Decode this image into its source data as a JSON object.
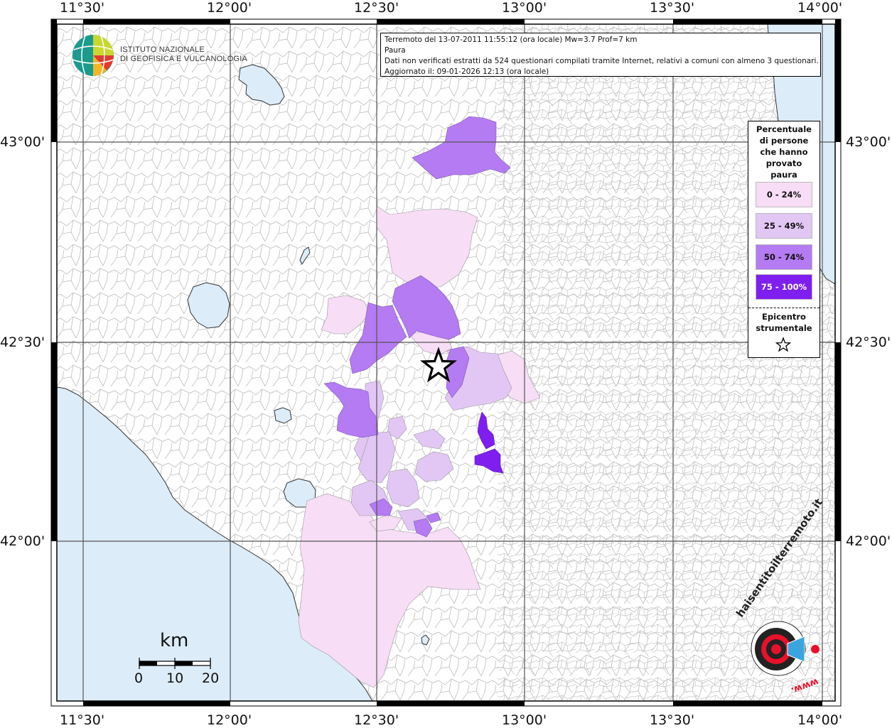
{
  "header": {
    "institute_line1": "ISTITUTO NAZIONALE",
    "institute_line2": "DI GEOFISICA E VULCANOLOGIA"
  },
  "info_box": {
    "line1": "Terremoto del 13-07-2011 11:55:12 (ora locale) Mw=3.7 Prof=7 km",
    "line2": "Paura",
    "line3": "Dati non verificati estratti da 524 questionari compilati tramite Internet, relativi a comuni con almeno 3 questionari.",
    "line4": "Aggiornato il: 09-01-2026 12:13 (ora locale)"
  },
  "axes": {
    "longitudes_top": [
      "11°30'",
      "12°00'",
      "12°30'",
      "13°00'",
      "13°30'",
      "14°00'"
    ],
    "longitudes_bottom": [
      "11°30'",
      "12°00'",
      "12°30'",
      "13°00'",
      "13°30'",
      "14°00'"
    ],
    "latitudes_left": [
      "43°00'",
      "42°30'",
      "42°00'"
    ],
    "latitudes_right": [
      "43°00'",
      "42°30'",
      "42°00'"
    ]
  },
  "legend": {
    "title_lines": [
      "Percentuale",
      "di persone",
      "che hanno",
      "provato",
      "paura"
    ],
    "classes": [
      {
        "label": "0 - 24%",
        "color": "#f7ddf6",
        "text_color": "#111"
      },
      {
        "label": "25 - 49%",
        "color": "#e2c7f5",
        "text_color": "#111"
      },
      {
        "label": "50 - 74%",
        "color": "#b57bf2",
        "text_color": "#111"
      },
      {
        "label": "75 - 100%",
        "color": "#7f1fef",
        "text_color": "#ffffff"
      }
    ],
    "epicenter_lines": [
      "Epicentro",
      "strumentale"
    ],
    "epicenter_icon": "star-outline-icon"
  },
  "scale_bar": {
    "unit": "km",
    "labels": [
      "0",
      "10",
      "20"
    ]
  },
  "footer_logo": {
    "text": "haisentitoilterremoto.it",
    "url_text": "www.",
    "icon": "target-megaphone-icon"
  },
  "colors": {
    "sea": "#dcecf8",
    "land": "#ffffff",
    "borders": "#bdbdbd",
    "grid": "#555555"
  }
}
